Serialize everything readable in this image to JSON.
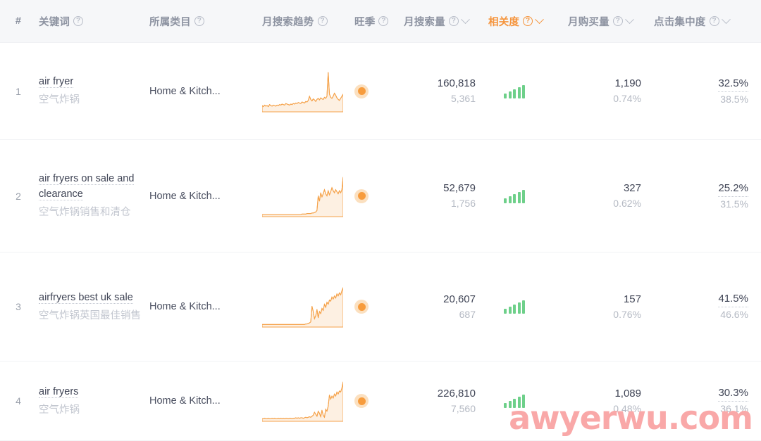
{
  "table": {
    "columns": [
      {
        "key": "index",
        "label": "#",
        "help": false,
        "sortable": false,
        "active": false
      },
      {
        "key": "keyword",
        "label": "关键词",
        "help": true,
        "sortable": false,
        "active": false
      },
      {
        "key": "category",
        "label": "所属类目",
        "help": true,
        "sortable": false,
        "active": false
      },
      {
        "key": "trend",
        "label": "月搜索趋势",
        "help": true,
        "sortable": false,
        "active": false
      },
      {
        "key": "season",
        "label": "旺季",
        "help": true,
        "sortable": false,
        "active": false
      },
      {
        "key": "volume",
        "label": "月搜索量",
        "help": true,
        "sortable": true,
        "active": false
      },
      {
        "key": "relevance",
        "label": "相关度",
        "help": true,
        "sortable": true,
        "active": true
      },
      {
        "key": "purchases",
        "label": "月购买量",
        "help": true,
        "sortable": true,
        "active": false
      },
      {
        "key": "clicks",
        "label": "点击集中度",
        "help": true,
        "sortable": true,
        "active": false
      }
    ],
    "help_glyph": "?",
    "rows": [
      {
        "index": "1",
        "keyword_en": "air fryer",
        "keyword_cn": "空气炸锅",
        "category": "Home & Kitch...",
        "season": "peak",
        "volume_main": "160,818",
        "volume_sub": "5,361",
        "relevance_bars": 5,
        "purchases_main": "1,190",
        "purchases_sub": "0.74%",
        "clicks_main": "32.5%",
        "clicks_sub": "38.5%"
      },
      {
        "index": "2",
        "keyword_en": "air fryers on sale and clearance",
        "keyword_cn": "空气炸锅销售和清仓",
        "category": "Home & Kitch...",
        "season": "peak",
        "volume_main": "52,679",
        "volume_sub": "1,756",
        "relevance_bars": 5,
        "purchases_main": "327",
        "purchases_sub": "0.62%",
        "clicks_main": "25.2%",
        "clicks_sub": "31.5%"
      },
      {
        "index": "3",
        "keyword_en": "airfryers best uk sale",
        "keyword_cn": "空气炸锅英国最佳销售",
        "category": "Home & Kitch...",
        "season": "peak",
        "volume_main": "20,607",
        "volume_sub": "687",
        "relevance_bars": 5,
        "purchases_main": "157",
        "purchases_sub": "0.76%",
        "clicks_main": "41.5%",
        "clicks_sub": "46.6%"
      },
      {
        "index": "4",
        "keyword_en": "air fryers",
        "keyword_cn": "空气炸锅",
        "category": "Home & Kitch...",
        "season": "peak",
        "volume_main": "226,810",
        "volume_sub": "7,560",
        "relevance_bars": 5,
        "purchases_main": "1,089",
        "purchases_sub": "0.48%",
        "clicks_main": "30.3%",
        "clicks_sub": "36.1%"
      }
    ]
  },
  "watermark": {
    "text": "awyerwu.com"
  },
  "colors": {
    "accent_orange": "#f5953e",
    "trend_line": "#f5a košt",
    "relevance_green": "#6ed08a",
    "header_bg": "#f6f7f9",
    "text_primary": "#3f4455",
    "text_muted": "#b4b9c3",
    "watermark_pink": "#f9a8a8"
  },
  "chart_data": [
    {
      "type": "line",
      "title": "月搜索趋势 - air fryer",
      "row": 1,
      "series": [
        {
          "name": "monthly search trend",
          "values": [
            12,
            10,
            13,
            11,
            12,
            10,
            14,
            12,
            11,
            13,
            12,
            11,
            13,
            12,
            14,
            13,
            15,
            14,
            13,
            16,
            15,
            14,
            13,
            15,
            14,
            16,
            15,
            17,
            16,
            18,
            17,
            16,
            19,
            18,
            17,
            20,
            19,
            22,
            30,
            24,
            21,
            25,
            23,
            20,
            24,
            26,
            23,
            27,
            25,
            24,
            28,
            26,
            30,
            76,
            34,
            28,
            26,
            30,
            36,
            32,
            27,
            24,
            22,
            26,
            30,
            34
          ]
        }
      ],
      "ylim": [
        0,
        80
      ],
      "grid": false
    },
    {
      "type": "line",
      "title": "月搜索趋势 - air fryers on sale and clearance",
      "row": 2,
      "series": [
        {
          "name": "monthly search trend",
          "values": [
            4,
            4,
            4,
            4,
            4,
            4,
            4,
            4,
            4,
            4,
            4,
            4,
            4,
            4,
            4,
            4,
            4,
            4,
            4,
            4,
            4,
            4,
            4,
            4,
            4,
            4,
            4,
            4,
            4,
            4,
            4,
            4,
            5,
            5,
            5,
            5,
            6,
            6,
            6,
            6,
            7,
            7,
            8,
            9,
            12,
            40,
            30,
            46,
            38,
            44,
            52,
            44,
            40,
            50,
            42,
            48,
            56,
            50,
            46,
            52,
            48,
            44,
            50,
            46,
            52,
            76
          ]
        }
      ],
      "ylim": [
        0,
        80
      ],
      "grid": false
    },
    {
      "type": "line",
      "title": "月搜索趋势 - airfryers best uk sale",
      "row": 3,
      "series": [
        {
          "name": "monthly search trend",
          "values": [
            5,
            5,
            5,
            5,
            5,
            5,
            5,
            5,
            5,
            5,
            5,
            5,
            5,
            5,
            5,
            5,
            5,
            5,
            5,
            5,
            5,
            5,
            5,
            5,
            5,
            5,
            5,
            5,
            5,
            5,
            5,
            5,
            5,
            5,
            5,
            6,
            6,
            7,
            8,
            10,
            40,
            30,
            16,
            22,
            34,
            18,
            30,
            26,
            36,
            32,
            44,
            38,
            48,
            44,
            52,
            50,
            58,
            54,
            60,
            56,
            64,
            60,
            66,
            62,
            70,
            76
          ]
        }
      ],
      "ylim": [
        0,
        80
      ],
      "grid": false
    },
    {
      "type": "line",
      "title": "月搜索趋势 - air fryers",
      "row": 4,
      "series": [
        {
          "name": "monthly search trend",
          "values": [
            5,
            5,
            6,
            5,
            5,
            6,
            5,
            5,
            6,
            5,
            6,
            5,
            5,
            6,
            5,
            6,
            5,
            6,
            5,
            6,
            6,
            5,
            6,
            6,
            5,
            6,
            6,
            7,
            6,
            7,
            6,
            7,
            7,
            6,
            7,
            8,
            7,
            8,
            9,
            8,
            10,
            12,
            18,
            14,
            10,
            20,
            16,
            9,
            22,
            12,
            8,
            24,
            20,
            30,
            52,
            44,
            50,
            46,
            54,
            50,
            58,
            54,
            60,
            58,
            66,
            78
          ]
        }
      ],
      "ylim": [
        0,
        80
      ],
      "grid": false
    }
  ]
}
